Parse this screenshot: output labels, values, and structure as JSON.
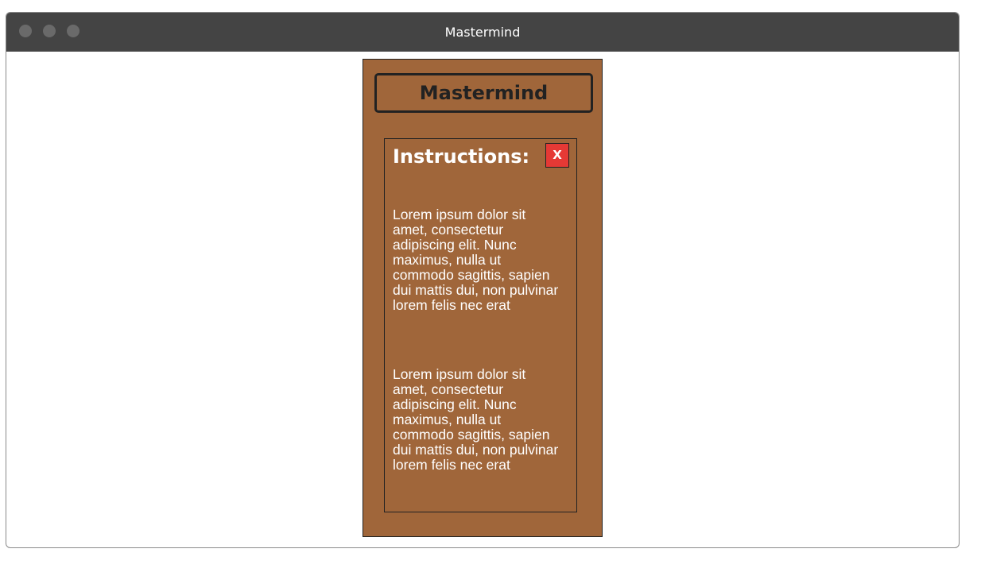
{
  "window": {
    "title": "Mastermind"
  },
  "app": {
    "title": "Mastermind",
    "panel_color": "#a0663a"
  },
  "instructions": {
    "heading": "Instructions:",
    "close_label": "X",
    "paragraphs": [
      "Lorem ipsum dolor sit amet, consectetur adipiscing elit. Nunc maximus, nulla ut commodo sagittis, sapien dui mattis dui, non pulvinar lorem felis nec erat",
      "Lorem ipsum dolor sit amet, consectetur adipiscing elit. Nunc maximus, nulla ut commodo sagittis, sapien dui mattis dui, non pulvinar lorem felis nec erat"
    ]
  },
  "colors": {
    "titlebar": "#444444",
    "close_button": "#e53935"
  }
}
